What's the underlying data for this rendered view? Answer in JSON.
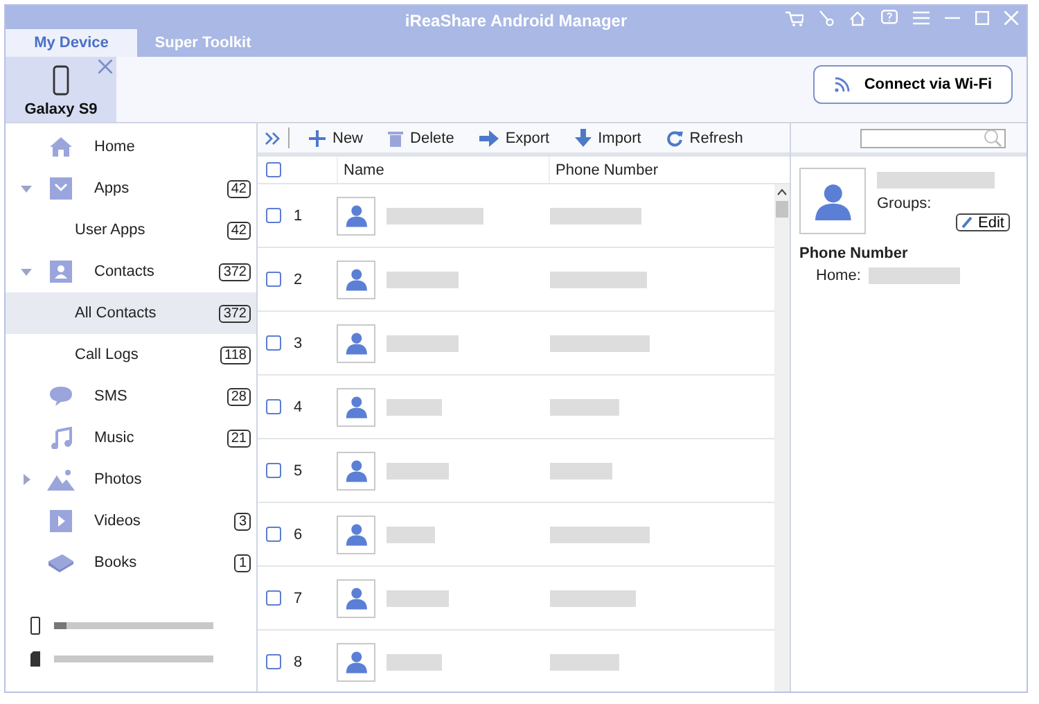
{
  "window": {
    "title": "iReaShare Android Manager"
  },
  "tabs": [
    {
      "label": "My Device",
      "selected": true
    },
    {
      "label": "Super Toolkit",
      "selected": false
    }
  ],
  "device": {
    "name": "Galaxy S9",
    "selected": true
  },
  "connect_button": "Connect via Wi-Fi",
  "sidebar": {
    "items": [
      {
        "label": "Home",
        "kind": "home"
      },
      {
        "label": "Apps",
        "kind": "apps",
        "count": "42",
        "expanded": true,
        "children": [
          {
            "label": "User Apps",
            "count": "42",
            "selected": false
          }
        ]
      },
      {
        "label": "Contacts",
        "kind": "contacts",
        "count": "372",
        "expanded": true,
        "children": [
          {
            "label": "All Contacts",
            "count": "372",
            "selected": true
          },
          {
            "label": "Call Logs",
            "count": "118",
            "selected": false
          }
        ]
      },
      {
        "label": "SMS",
        "kind": "sms",
        "count": "28"
      },
      {
        "label": "Music",
        "kind": "music",
        "count": "21"
      },
      {
        "label": "Photos",
        "kind": "photos",
        "expanded": false
      },
      {
        "label": "Videos",
        "kind": "videos",
        "count": "3"
      },
      {
        "label": "Books",
        "kind": "books",
        "count": "1"
      }
    ],
    "storage": [
      {
        "kind": "phone",
        "level": 0.08
      },
      {
        "kind": "sd"
      }
    ]
  },
  "toolbar": [
    {
      "label": "New",
      "kind": "new"
    },
    {
      "label": "Delete",
      "kind": "delete"
    },
    {
      "label": "Export",
      "kind": "export"
    },
    {
      "label": "Import",
      "kind": "import"
    },
    {
      "label": "Refresh",
      "kind": "refresh"
    }
  ],
  "table": {
    "columns": [
      "Name",
      "Phone Number"
    ],
    "all_checked": false,
    "rows": [
      {
        "number": "1",
        "checked": false
      },
      {
        "number": "2",
        "checked": false
      },
      {
        "number": "3",
        "checked": false
      },
      {
        "number": "4",
        "checked": false
      },
      {
        "number": "5",
        "checked": false
      },
      {
        "number": "6",
        "checked": false
      },
      {
        "number": "7",
        "checked": false
      },
      {
        "number": "8",
        "checked": false
      }
    ]
  },
  "details": {
    "groups_label": "Groups:",
    "edit_button": "Edit",
    "section_title": "Phone Number",
    "home_label": "Home:"
  }
}
